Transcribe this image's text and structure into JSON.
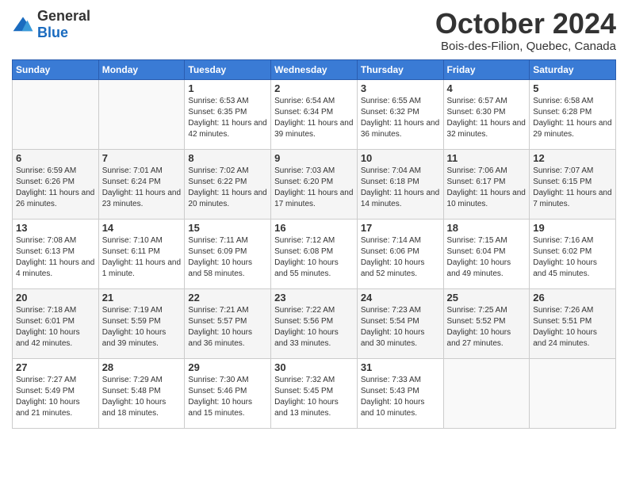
{
  "logo": {
    "general": "General",
    "blue": "Blue"
  },
  "title": "October 2024",
  "location": "Bois-des-Filion, Quebec, Canada",
  "days_of_week": [
    "Sunday",
    "Monday",
    "Tuesday",
    "Wednesday",
    "Thursday",
    "Friday",
    "Saturday"
  ],
  "weeks": [
    [
      {
        "day": "",
        "info": ""
      },
      {
        "day": "",
        "info": ""
      },
      {
        "day": "1",
        "info": "Sunrise: 6:53 AM\nSunset: 6:35 PM\nDaylight: 11 hours and 42 minutes."
      },
      {
        "day": "2",
        "info": "Sunrise: 6:54 AM\nSunset: 6:34 PM\nDaylight: 11 hours and 39 minutes."
      },
      {
        "day": "3",
        "info": "Sunrise: 6:55 AM\nSunset: 6:32 PM\nDaylight: 11 hours and 36 minutes."
      },
      {
        "day": "4",
        "info": "Sunrise: 6:57 AM\nSunset: 6:30 PM\nDaylight: 11 hours and 32 minutes."
      },
      {
        "day": "5",
        "info": "Sunrise: 6:58 AM\nSunset: 6:28 PM\nDaylight: 11 hours and 29 minutes."
      }
    ],
    [
      {
        "day": "6",
        "info": "Sunrise: 6:59 AM\nSunset: 6:26 PM\nDaylight: 11 hours and 26 minutes."
      },
      {
        "day": "7",
        "info": "Sunrise: 7:01 AM\nSunset: 6:24 PM\nDaylight: 11 hours and 23 minutes."
      },
      {
        "day": "8",
        "info": "Sunrise: 7:02 AM\nSunset: 6:22 PM\nDaylight: 11 hours and 20 minutes."
      },
      {
        "day": "9",
        "info": "Sunrise: 7:03 AM\nSunset: 6:20 PM\nDaylight: 11 hours and 17 minutes."
      },
      {
        "day": "10",
        "info": "Sunrise: 7:04 AM\nSunset: 6:18 PM\nDaylight: 11 hours and 14 minutes."
      },
      {
        "day": "11",
        "info": "Sunrise: 7:06 AM\nSunset: 6:17 PM\nDaylight: 11 hours and 10 minutes."
      },
      {
        "day": "12",
        "info": "Sunrise: 7:07 AM\nSunset: 6:15 PM\nDaylight: 11 hours and 7 minutes."
      }
    ],
    [
      {
        "day": "13",
        "info": "Sunrise: 7:08 AM\nSunset: 6:13 PM\nDaylight: 11 hours and 4 minutes."
      },
      {
        "day": "14",
        "info": "Sunrise: 7:10 AM\nSunset: 6:11 PM\nDaylight: 11 hours and 1 minute."
      },
      {
        "day": "15",
        "info": "Sunrise: 7:11 AM\nSunset: 6:09 PM\nDaylight: 10 hours and 58 minutes."
      },
      {
        "day": "16",
        "info": "Sunrise: 7:12 AM\nSunset: 6:08 PM\nDaylight: 10 hours and 55 minutes."
      },
      {
        "day": "17",
        "info": "Sunrise: 7:14 AM\nSunset: 6:06 PM\nDaylight: 10 hours and 52 minutes."
      },
      {
        "day": "18",
        "info": "Sunrise: 7:15 AM\nSunset: 6:04 PM\nDaylight: 10 hours and 49 minutes."
      },
      {
        "day": "19",
        "info": "Sunrise: 7:16 AM\nSunset: 6:02 PM\nDaylight: 10 hours and 45 minutes."
      }
    ],
    [
      {
        "day": "20",
        "info": "Sunrise: 7:18 AM\nSunset: 6:01 PM\nDaylight: 10 hours and 42 minutes."
      },
      {
        "day": "21",
        "info": "Sunrise: 7:19 AM\nSunset: 5:59 PM\nDaylight: 10 hours and 39 minutes."
      },
      {
        "day": "22",
        "info": "Sunrise: 7:21 AM\nSunset: 5:57 PM\nDaylight: 10 hours and 36 minutes."
      },
      {
        "day": "23",
        "info": "Sunrise: 7:22 AM\nSunset: 5:56 PM\nDaylight: 10 hours and 33 minutes."
      },
      {
        "day": "24",
        "info": "Sunrise: 7:23 AM\nSunset: 5:54 PM\nDaylight: 10 hours and 30 minutes."
      },
      {
        "day": "25",
        "info": "Sunrise: 7:25 AM\nSunset: 5:52 PM\nDaylight: 10 hours and 27 minutes."
      },
      {
        "day": "26",
        "info": "Sunrise: 7:26 AM\nSunset: 5:51 PM\nDaylight: 10 hours and 24 minutes."
      }
    ],
    [
      {
        "day": "27",
        "info": "Sunrise: 7:27 AM\nSunset: 5:49 PM\nDaylight: 10 hours and 21 minutes."
      },
      {
        "day": "28",
        "info": "Sunrise: 7:29 AM\nSunset: 5:48 PM\nDaylight: 10 hours and 18 minutes."
      },
      {
        "day": "29",
        "info": "Sunrise: 7:30 AM\nSunset: 5:46 PM\nDaylight: 10 hours and 15 minutes."
      },
      {
        "day": "30",
        "info": "Sunrise: 7:32 AM\nSunset: 5:45 PM\nDaylight: 10 hours and 13 minutes."
      },
      {
        "day": "31",
        "info": "Sunrise: 7:33 AM\nSunset: 5:43 PM\nDaylight: 10 hours and 10 minutes."
      },
      {
        "day": "",
        "info": ""
      },
      {
        "day": "",
        "info": ""
      }
    ]
  ]
}
